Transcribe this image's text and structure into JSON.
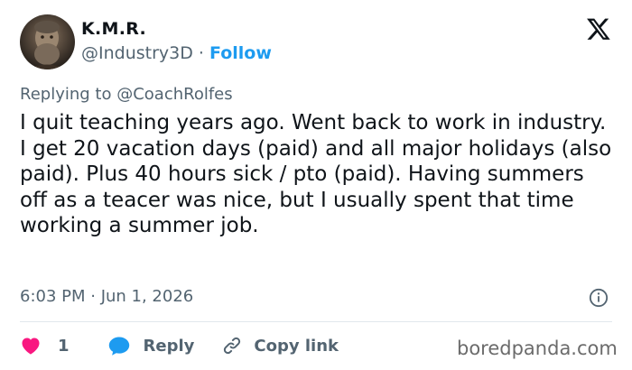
{
  "author": {
    "name": "K.M.R.",
    "handle": "@Industry3D",
    "separator": "·",
    "follow_label": "Follow"
  },
  "reply_context": {
    "prefix": "Replying to",
    "mention": "@CoachRolfes"
  },
  "tweet": {
    "text": "I quit teaching years ago. Went back to work in industry. I get 20 vacation days (paid) and all major holidays (also paid). Plus 40 hours sick / pto (paid). Having summers off as a teacer was nice, but I usually spent that time working a summer job.",
    "timestamp": "6:03 PM · Jun 1, 2026"
  },
  "actions": {
    "like_count": "1",
    "reply_label": "Reply",
    "copy_link_label": "Copy link"
  },
  "watermark": "boredpanda.com",
  "icons": {
    "logo": "x-logo-icon",
    "info": "info-icon",
    "like": "heart-icon",
    "reply": "reply-bubble-icon",
    "copy": "link-icon"
  },
  "colors": {
    "accent": "#1d9bf0",
    "like": "#f91880",
    "text": "#0f1419",
    "muted": "#536471"
  }
}
